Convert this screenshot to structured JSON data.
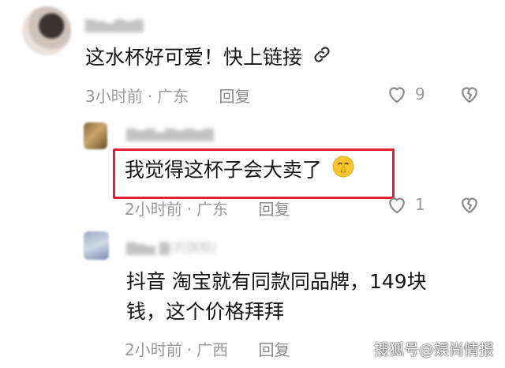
{
  "comments": [
    {
      "username": "▇▆▅▇▆▇",
      "text": "这水杯好可爱！快上链接",
      "time": "3小时前",
      "location": "广东",
      "reply": "回复",
      "likes": "9",
      "icon": "link-icon"
    },
    {
      "username": "▇▆▇▅▇▆▇▆▇",
      "text": "我觉得这杯子会大卖了",
      "time": "2小时前",
      "location": "广东",
      "reply": "回复",
      "likes": "1",
      "icon": "shushing-face-emoji",
      "highlight_color": "#e3202c"
    },
    {
      "username": "▇▆▅ ▇(的旗舰)",
      "text_line1": "抖音  淘宝就有同款同品牌，149块",
      "text_line2": "钱，这个价格拜拜",
      "time": "2小时前",
      "location": "广西",
      "reply": "回复"
    }
  ],
  "watermark": "搜狐号@娱尚情报"
}
